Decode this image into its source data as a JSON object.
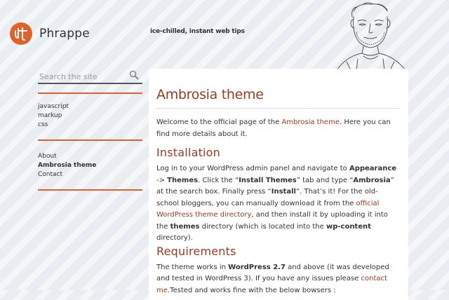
{
  "header": {
    "site_name": "Phrappe",
    "tagline": "ice-chilled, instant web tips",
    "brand_color": "#e0622b"
  },
  "sidebar": {
    "search_placeholder": "Search the site",
    "categories": [
      "javascript",
      "markup",
      "css"
    ],
    "pages": [
      {
        "label": "About",
        "current": false
      },
      {
        "label": "Ambrosia theme",
        "current": true
      },
      {
        "label": "Contact",
        "current": false
      }
    ],
    "rule_color": "#e0622b"
  },
  "main": {
    "title": "Ambrosia theme",
    "intro": {
      "t1": "Welcome to the official page of the ",
      "link": "Ambrosia theme",
      "t2": ". Here you can find more details about it."
    },
    "installation": {
      "heading": "Installation",
      "t1": "Log in to your WordPress admin panel and navigate to ",
      "b1": "Appearance",
      "t2": " -> ",
      "b2": "Themes",
      "t3": ". Click the “",
      "b3": "Install Themes",
      "t4": "” tab and type “",
      "b4": "Ambrosia",
      "t5": "” at the search box. Finally press “",
      "b5": "Install",
      "t6": "“. That’s it! For the old-school bloggers, you can manually download it from the ",
      "link": "official WordPress theme directory",
      "t7": ", and then install it by uploading it into the ",
      "b6": "themes",
      "t8": " directory (which is located into the ",
      "b7": "wp-content",
      "t9": " directory)."
    },
    "requirements": {
      "heading": "Requirements",
      "t1": "The theme works in ",
      "b1": "WordPress 2.7",
      "t2": " and above (it was developed and tested in WordPress 3). If you have any issues please ",
      "link": "contact me",
      "t3": ".Tested and works fine with the below bowsers :"
    },
    "accent_color": "#9a3b1f"
  }
}
